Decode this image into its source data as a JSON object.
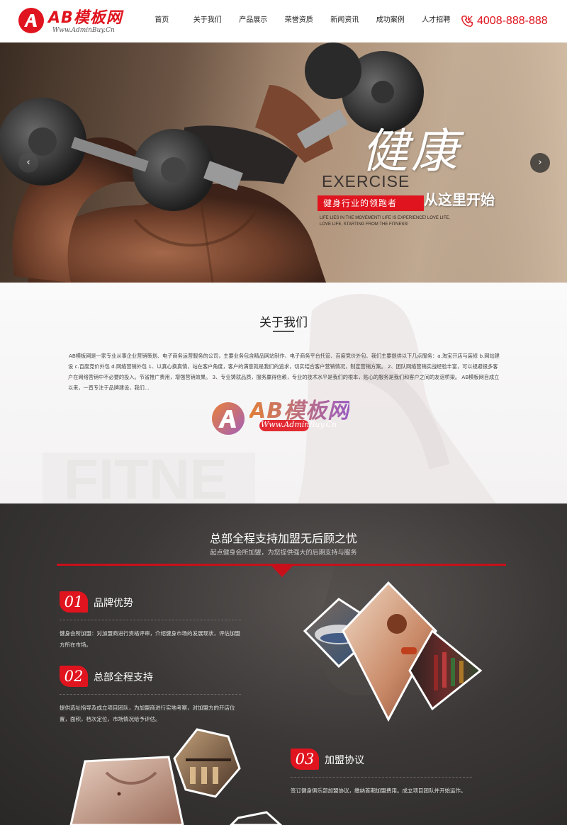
{
  "header": {
    "logo_text": "AB模板网",
    "logo_sub": "Www.AdminBuy.Cn",
    "nav": [
      "首页",
      "关于我们",
      "产品展示",
      "荣誉资质",
      "新闻资讯",
      "成功案例",
      "人才招聘"
    ],
    "phone": "4008-888-888"
  },
  "banner": {
    "title": "健康",
    "exercise": "EXERCISE",
    "leader": "健身行业的领跑者",
    "start": "从这里开始",
    "slogan": "LIFE LIES IN THE MOVEMENT! LIFE IS EXPERIENCE! LOVE LIFE, LOVE LIFE, STARTING FROM THE FITNESS!",
    "prev": "‹",
    "next": "›"
  },
  "about": {
    "title": "关于我们",
    "text": "AB模板网是一家专业从事企业营销策划、电子商务运营服务的公司，主要业务包含精品网站制作、电子商务平台托管、百度竞价外包、我们主要提供以下几点服务：a.淘宝开店与装修 b.网站建设 c.百度竞价外包 d.网络营销外包 1、以真心换真情，站在客户角度，客户的满意就是我们的追求，切实结合客户营销情况，制定营销方案。 2、团队网络营销实战经验丰富，可以规避很多客户在网络营销中不必要的投入。节省推广费用，增强营销效果。 3、专业铸就品质，服务赢得信赖，专业的技术水平是我们的根本，贴心的服务是我们和客户之间的友谊桥梁。 AB模板网自成立以来，一直专注于品牌建设，我们...",
    "watermark": "AB模板网",
    "watermark_sub": "Www.AdminBuy.Cn"
  },
  "franchise": {
    "title": "总部全程支持加盟无后顾之忧",
    "subtitle": "起点健身会所加盟，为您提供强大的后期支持与服务",
    "features": [
      {
        "num": "01",
        "title": "品牌优势",
        "desc": "健身会所加盟：对加盟商进行资格评审，介绍健身市场的发展现状，评估加盟方所在市场。"
      },
      {
        "num": "02",
        "title": "总部全程支持",
        "desc": "提供选址指导及成立项目团队，为加盟商进行实地考察，对加盟方的开店位置，面积，档次定位，市场情况给予评估。"
      },
      {
        "num": "03",
        "title": "加盟协议",
        "desc": "签订健身俱乐部加盟协议，缴纳首期加盟费用。成立项目团队并开始运作。"
      }
    ]
  }
}
